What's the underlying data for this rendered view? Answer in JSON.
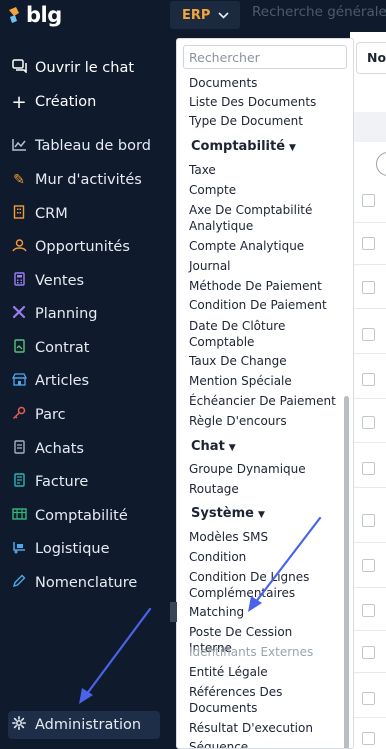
{
  "sidebar": {
    "logo_text": "blg",
    "top_items": [
      {
        "label": "Ouvrir le chat",
        "icon": "chat-icon"
      },
      {
        "label": "Création",
        "icon": "plus-icon"
      }
    ],
    "items": [
      {
        "label": "Tableau de bord",
        "icon": "chart-line-icon"
      },
      {
        "label": "Mur d'activités",
        "icon": "edit-icon"
      },
      {
        "label": "CRM",
        "icon": "building-icon"
      },
      {
        "label": "Opportunités",
        "icon": "handshake-icon"
      },
      {
        "label": "Ventes",
        "icon": "calculator-icon"
      },
      {
        "label": "Planning",
        "icon": "tools-icon"
      },
      {
        "label": "Contrat",
        "icon": "contract-icon"
      },
      {
        "label": "Articles",
        "icon": "store-icon"
      },
      {
        "label": "Parc",
        "icon": "key-icon"
      },
      {
        "label": "Achats",
        "icon": "receipt-icon"
      },
      {
        "label": "Facture",
        "icon": "invoice-icon"
      },
      {
        "label": "Comptabilité",
        "icon": "ledger-icon"
      },
      {
        "label": "Logistique",
        "icon": "truck-icon"
      },
      {
        "label": "Nomenclature",
        "icon": "pen-icon"
      }
    ],
    "admin": {
      "label": "Administration",
      "icon": "gear-icon"
    }
  },
  "topbar": {
    "module": "ERP",
    "search_placeholder": "Recherche générale"
  },
  "content": {
    "column_label": "Nom"
  },
  "dropdown": {
    "search_placeholder": "Rechercher",
    "items_before": [
      "Documents",
      "Liste Des Documents",
      "Type De Document"
    ],
    "comptabilite": {
      "header": "Comptabilité",
      "items": [
        "Taxe",
        "Compte",
        "Axe De Comptabilité Analytique",
        "Compte Analytique",
        "Journal",
        "Méthode De Paiement",
        "Condition De Paiement",
        "Date De Clôture Comptable",
        "Taux De Change",
        "Mention Spéciale",
        "Échéancier De Paiement",
        "Règle D'encours"
      ]
    },
    "chat": {
      "header": "Chat",
      "items": [
        "Groupe Dynamique",
        "Routage"
      ]
    },
    "systeme": {
      "header": "Système",
      "items": [
        "Modèles SMS",
        "Condition",
        "Condition De Lignes Complémentaires",
        "Matching",
        "Poste De Cession Interne",
        "Identifiants Externes",
        "Entité Légale",
        "Références Des Documents",
        "Résultat D'execution",
        "Séquence"
      ]
    }
  },
  "colors": {
    "sidebar_bg": "#0f1b2d",
    "accent_orange": "#f3a43b",
    "arrow": "#4b63e8"
  }
}
